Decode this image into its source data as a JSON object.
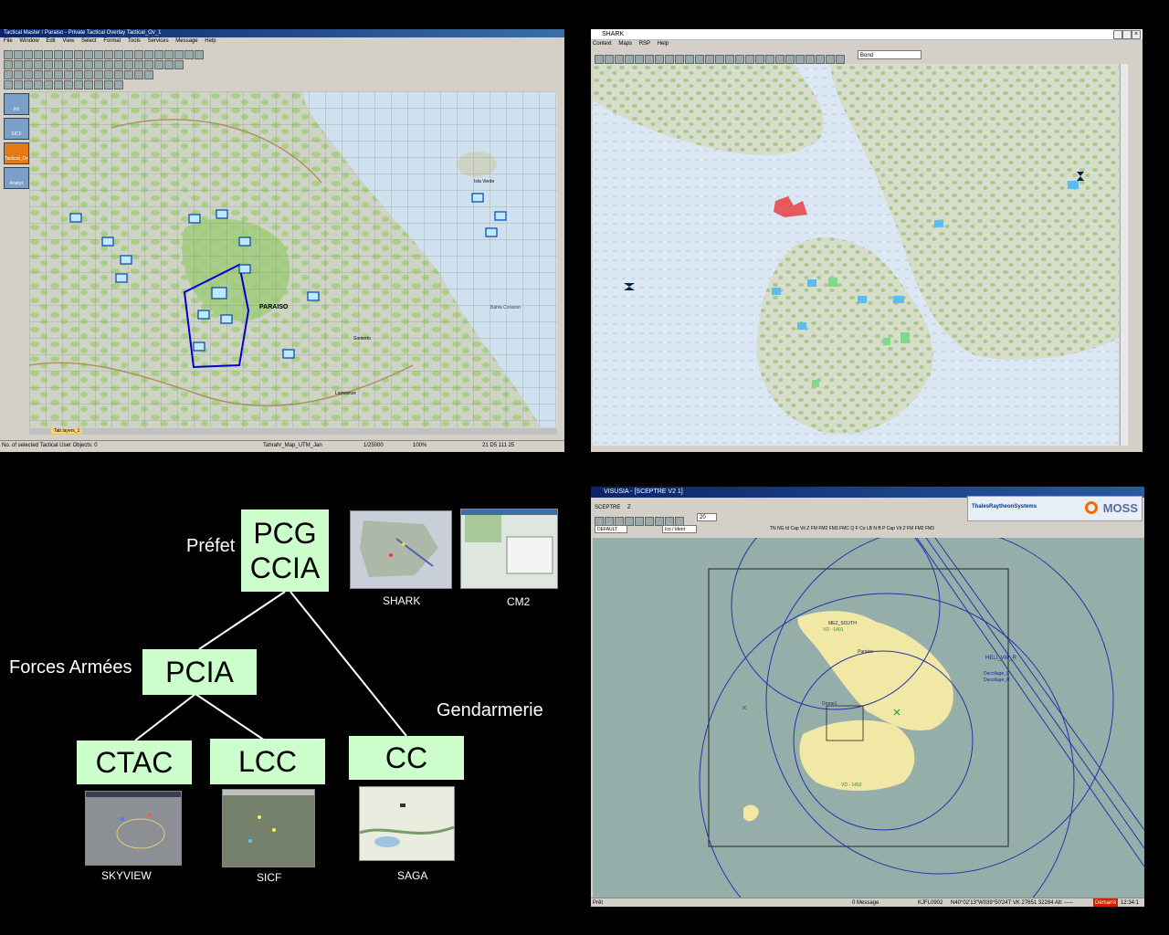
{
  "tactical_window": {
    "title": "Tactical Master / Paraiso - Private Tactical Overlay Tactical_Ov_1",
    "menu": [
      "File",
      "Window",
      "Edit",
      "View",
      "Select",
      "Format",
      "Tools",
      "Services",
      "Message",
      "Help"
    ],
    "side_buttons": [
      "Kit",
      "SICF",
      "Tactical_Ov",
      "Analys"
    ],
    "map_labels": [
      "PARAISO",
      "Bahia Corazon",
      "Isla Verde",
      "Somerto",
      "Lanwanze"
    ],
    "tab_label": "Tab.layers_1",
    "status": {
      "left": "No. of selected Tactical User Objects: 0",
      "map": "Tahrahr_Map_UTM_Jan",
      "scale": "1/25000",
      "zoom": "100%",
      "coords": "21 D5 111 25 "
    }
  },
  "shark_window": {
    "title": "SHARK",
    "menu": [
      "Context",
      "Maps",
      "RSP",
      "Help"
    ],
    "dropdown_value": "Bond"
  },
  "diagram": {
    "nodes": {
      "pcg": "PCG\nCCIA",
      "pcia": "PCIA",
      "ctac": "CTAC",
      "lcc": "LCC",
      "cc": "CC"
    },
    "labels": {
      "prefet": "Préfet",
      "forces": "Forces Armées",
      "gendarmerie": "Gendarmerie"
    },
    "thumbnails": [
      "SHARK",
      "CM2",
      "SKYVIEW",
      "SICF",
      "SAGA"
    ]
  },
  "visusia_window": {
    "title": "VISUSIA - [SCEPTRE V2 1]",
    "menu": [
      "SCEPTRE",
      "Z"
    ],
    "brand": "ThalesRaytheonSystems",
    "brand2": "MOSS",
    "dropdowns": {
      "profile": "DEFAULT",
      "mode": "Ico / Ident",
      "zoom": "20"
    },
    "toolbar_codes": [
      "TN",
      "NG",
      "Id",
      "Cap",
      "Vit",
      "Z",
      "FM",
      "FM2",
      "FM3",
      "FMC",
      "Q",
      "F",
      "Co",
      "LB",
      "N",
      "B",
      "P",
      "Cap",
      "Vit",
      "Z",
      "FM",
      "FM2",
      "FM3"
    ],
    "map_labels": {
      "mez_south": "MEZ_SOUTH",
      "vd1401": "VD - 1401",
      "paraiso": "Paraiso",
      "heli": "HELI_VIP_R",
      "decollage_l": "Decollage_L",
      "decollage_r": "Decollage_R",
      "drone": "Drone1",
      "vd1452": "VD - 1452"
    },
    "status": {
      "left": "Prêt",
      "messages": "0 Message",
      "id": "KJFL0902",
      "coords": "N40°02'13\"W039°50'24T VK 27651 32284 Alt: -----",
      "state": "Démarré",
      "time": "12:34:1"
    }
  },
  "colors": {
    "node_fill": "#ccffcc",
    "xp_title": "#0a246a",
    "radar_sea": "#96aeaa",
    "radar_land": "#f2e8a6",
    "terrain_green": "#9ccc78",
    "sea_blue": "#cfe0f0",
    "status_red": "#cc2200"
  }
}
